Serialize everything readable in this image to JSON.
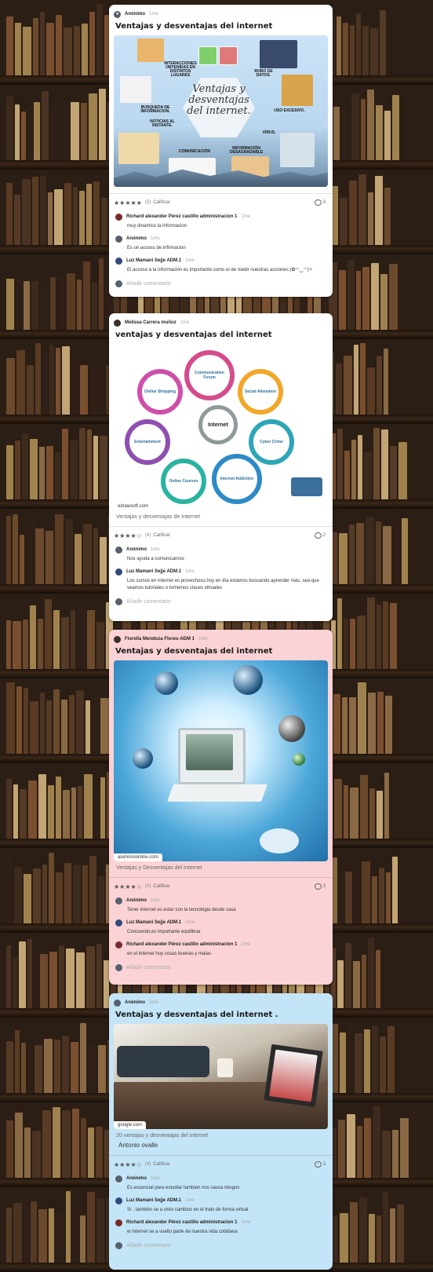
{
  "posts": [
    {
      "author": "Anónimo",
      "time": "1me",
      "title": "Ventajas y desventajas del internet",
      "image": {
        "center_text": "Ventajas y desventajas del internet.",
        "labels": [
          "INTERACCIONES OBTENIDAS EN DISTINTOS LUGARES",
          "ROBO DE DATOS.",
          "BUSQUEDA DE INFORMACION.",
          "USO EXCESIVO.",
          "NOTICIAS AL INSTANTE.",
          "VIRUS.",
          "COMUNICACIÓN",
          "INFORMACIÓN DESAGRADABLE"
        ]
      },
      "rating_count": "(5)",
      "rate_label": "Calificar",
      "comment_count": "3",
      "comments": [
        {
          "author": "Richard alexander Pérez castillo administracion 1",
          "time": "1me",
          "text": "muy dinamico la informacion"
        },
        {
          "author": "Anónimo",
          "time": "1me",
          "text": "Es un access de infirmacion"
        },
        {
          "author": "Luz Mamani Sejje ADM.1",
          "time": "1me",
          "text": "El acceso a la información es importante como el de medir nuestras acciones (✿◠‿◠)✧"
        }
      ],
      "add_comment": "Añadir comentario"
    },
    {
      "author": "Melissa Carrera muñoz",
      "time": "1me",
      "title": "ventajas y desventajas del internet",
      "image": {
        "center": "Internet",
        "nodes": [
          "Communication Forum",
          "Social Alienation",
          "Cyber Crime",
          "Internet Addiction",
          "Online Courses",
          "Entertainment",
          "Online Shopping"
        ],
        "source": "edrawsoft.com"
      },
      "caption": "Ventajas y desventajas de Internet",
      "rating_count": "(4)",
      "rate_label": "Calificar",
      "comment_count": "2",
      "comments": [
        {
          "author": "Anónimo",
          "time": "1me",
          "text": "Nos ayuda a comunicarnos"
        },
        {
          "author": "Luz Mamani Sejje ADM.1",
          "time": "1me",
          "text": "Los cursos en internet es provechoso,hoy en día estamos buscando aprender más, sea que veamos tutoriales o tomemos clases virtuales"
        }
      ],
      "add_comment": "Añadir comentario"
    },
    {
      "author": "Fiorella Mendoza Flores-ADM 1",
      "time": "1me",
      "title": "Ventajas y desventajas del internet",
      "image": {
        "source": "alumnosonline.com"
      },
      "caption": "Ventajas y Desventajas del Internet",
      "rating_count": "(3)",
      "rate_label": "Calificar",
      "comment_count": "3",
      "comments": [
        {
          "author": "Anónimo",
          "time": "1me",
          "text": "Tener internet es estar con la tecnologia desde casa"
        },
        {
          "author": "Luz Mamani Sejje ADM.1",
          "time": "1me",
          "text": "Concuerdo,es importante equilibrar"
        },
        {
          "author": "Richard alexander Pérez castillo administracion 1",
          "time": "1me",
          "text": "en el internet hoy cosas buenas y malas"
        }
      ],
      "add_comment": "Añadir comentario"
    },
    {
      "author": "Anónimo",
      "time": "1me",
      "title": "Ventajas y desventajas del internet .",
      "image": {
        "source": "google.com"
      },
      "caption": "20 ventajas y desventajas del internet",
      "body": "Antonio ovalle",
      "rating_count": "(4)",
      "rate_label": "Calificar",
      "comment_count": "3",
      "comments": [
        {
          "author": "Anónimo",
          "time": "1me",
          "text": "Es escencial para estudiar tambien nos causa riesgos"
        },
        {
          "author": "Luz Mamani Sejje ADM.1",
          "time": "1me",
          "text": "Sí , también se a visto cambios en el trato de forma virtual"
        },
        {
          "author": "Richard alexander Pérez castillo administracion 1",
          "time": "1me",
          "text": "el internet se a vuelto parte de nuestra vida cotidiana"
        }
      ],
      "add_comment": "Añadir comentario"
    }
  ],
  "colors": {
    "card_white": "#ffffff",
    "card_pink": "#fbd3d6",
    "card_blue": "#c4e5f7",
    "shelf_wood": "#3a2718"
  },
  "icons": [
    "user-avatar-icon",
    "star-icon",
    "comment-bubble-icon"
  ]
}
